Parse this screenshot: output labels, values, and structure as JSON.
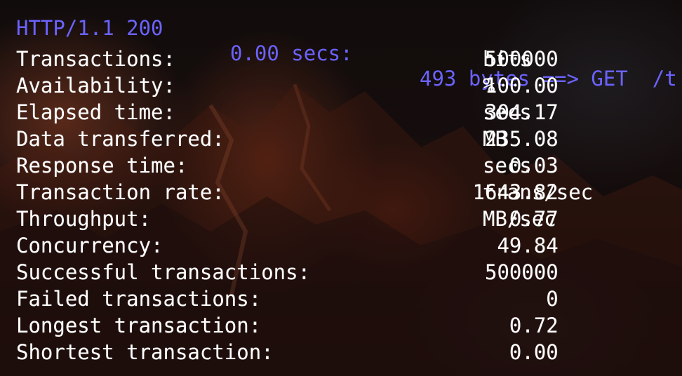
{
  "header": {
    "protocol_status": "HTTP/1.1 200",
    "time": "0.00 secs:",
    "bytes": "493 bytes ==> GET  /t"
  },
  "stats": [
    {
      "label": "Transactions:",
      "value": "500000",
      "unit": "hits"
    },
    {
      "label": "Availability:",
      "value": "100.00",
      "unit": "%"
    },
    {
      "label": "Elapsed time:",
      "value": "304.17",
      "unit": "secs"
    },
    {
      "label": "Data transferred:",
      "value": "235.08",
      "unit": "MB"
    },
    {
      "label": "Response time:",
      "value": "0.03",
      "unit": "secs"
    },
    {
      "label": "Transaction rate:",
      "value": "1643.82",
      "unit": "trans/sec"
    },
    {
      "label": "Throughput:",
      "value": "0.77",
      "unit": "MB/sec"
    },
    {
      "label": "Concurrency:",
      "value": "49.84",
      "unit": ""
    },
    {
      "label": "Successful transactions:",
      "value": "500000",
      "unit": ""
    },
    {
      "label": "Failed transactions:",
      "value": "0",
      "unit": ""
    },
    {
      "label": "Longest transaction:",
      "value": "0.72",
      "unit": ""
    },
    {
      "label": "Shortest transaction:",
      "value": "0.00",
      "unit": ""
    }
  ],
  "colors": {
    "header_text": "#6b63ff",
    "body_text": "#ffffff",
    "background": "#0e0a0a"
  }
}
